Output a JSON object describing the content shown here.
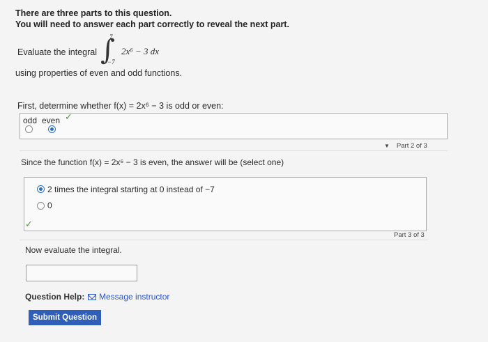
{
  "intro": {
    "line1": "There are three parts to this question.",
    "line2": "You will need to answer each part correctly to reveal the next part."
  },
  "problem": {
    "evaluate_text": "Evaluate the integral",
    "integral_upper": "7",
    "integral_lower": "−7",
    "integrand": "2x⁶ − 3 dx",
    "using_text": "using properties of even and odd functions."
  },
  "part1": {
    "prompt": "First, determine whether f(x) = 2x⁶ − 3 is odd or even:",
    "option_odd": "odd",
    "option_even": "even",
    "selected": "even"
  },
  "part2": {
    "indicator": "Part 2 of 3",
    "prompt": "Since the function f(x) = 2x⁶ − 3 is even, the answer will be (select one)",
    "option1": "2 times the integral starting at 0 instead of −7",
    "option2": "0",
    "selected": "option1"
  },
  "part3": {
    "indicator": "Part 3 of 3",
    "prompt": "Now evaluate the integral.",
    "answer_value": ""
  },
  "footer": {
    "help_label": "Question Help:",
    "message_label": "Message instructor",
    "submit_label": "Submit Question"
  },
  "colors": {
    "accent": "#2f5fb8",
    "check": "#4a9a3a"
  }
}
